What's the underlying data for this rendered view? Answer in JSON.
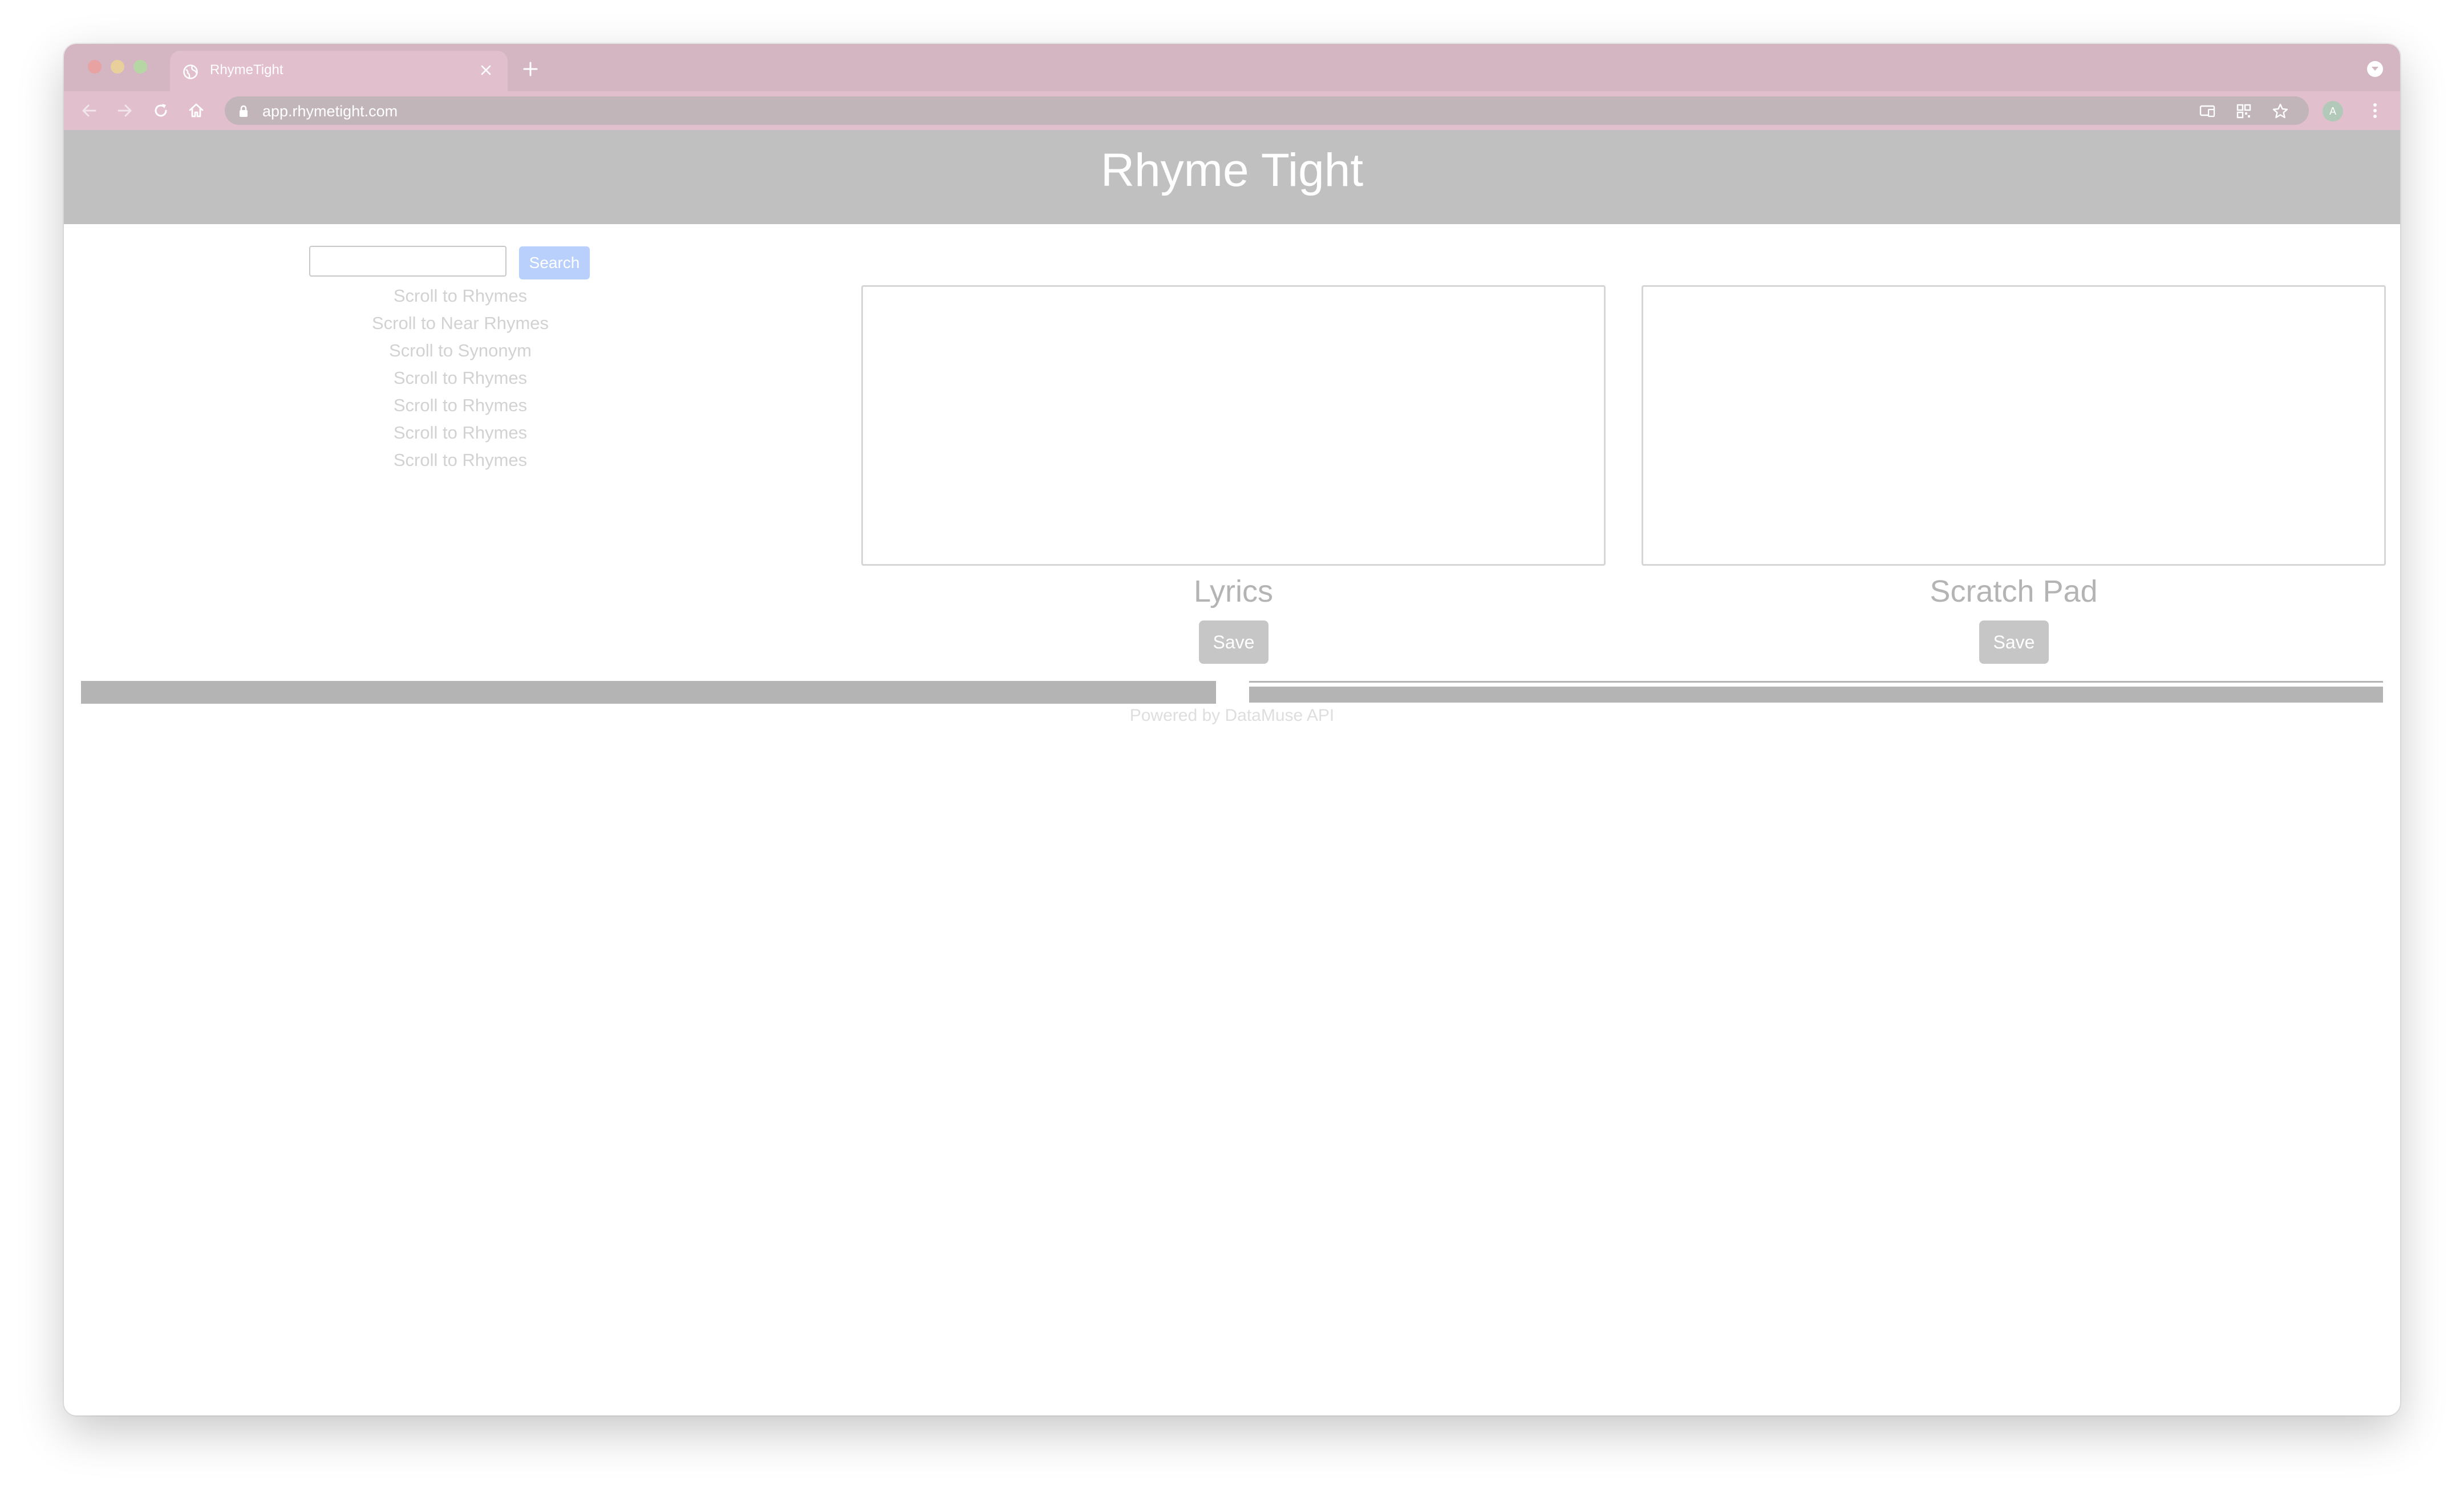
{
  "browser": {
    "tab": {
      "title": "RhymeTight",
      "favicon": "globe-icon",
      "close_icon": "close-icon"
    },
    "new_tab_icon": "plus-icon",
    "tab_menu_icon": "chevron-down-icon",
    "nav": {
      "back_icon": "arrow-left-icon",
      "forward_icon": "arrow-right-icon",
      "reload_icon": "reload-icon",
      "home_icon": "home-icon"
    },
    "address_bar": {
      "url": "app.rhymetight.com",
      "lock_icon": "lock-icon"
    },
    "toolbar_icons": [
      "cast-icon",
      "qr-code-icon",
      "star-icon"
    ],
    "profile_initial": "A",
    "menu_icon": "more-vertical-icon"
  },
  "app": {
    "title": "Rhyme Tight",
    "search": {
      "value": "",
      "placeholder": "",
      "button_label": "Search"
    },
    "scroll_links": [
      "Scroll to Rhymes",
      "Scroll to Near Rhymes",
      "Scroll to Synonym",
      "Scroll to Rhymes",
      "Scroll to Rhymes",
      "Scroll to Rhymes",
      "Scroll to Rhymes"
    ],
    "lyrics": {
      "title": "Lyrics",
      "value": "",
      "save_label": "Save"
    },
    "scratch_pad": {
      "title": "Scratch Pad",
      "value": "",
      "save_label": "Save"
    },
    "footer": {
      "prefix": "Powered by ",
      "link": "DataMuse API"
    }
  },
  "colors": {
    "tab_strip": "#d3b6c2",
    "toolbar": "#e2bfcc",
    "header": "#c0c0c0",
    "search_button": "#b8d0fb",
    "save_button": "#c6c6c6"
  }
}
